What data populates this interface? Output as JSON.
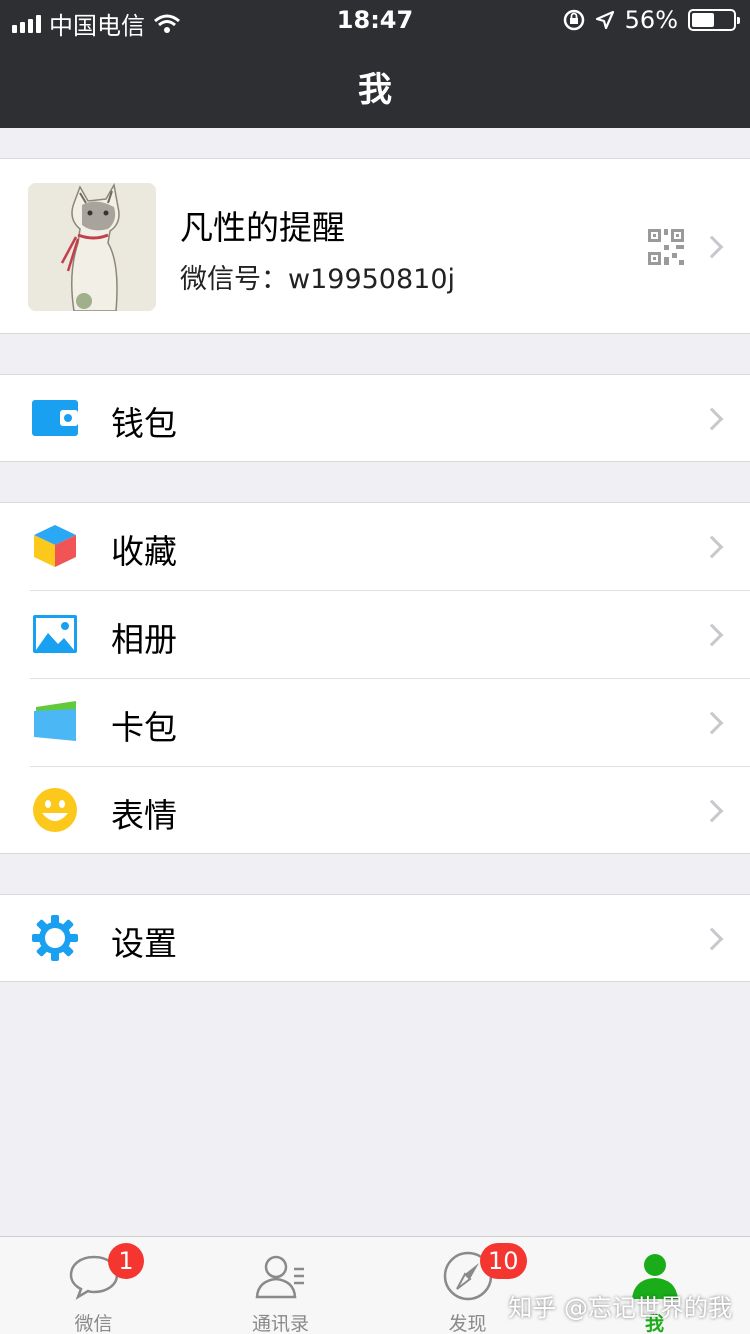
{
  "status_bar": {
    "carrier": "中国电信",
    "time": "18:47",
    "battery": "56%",
    "battery_level": 0.56
  },
  "nav": {
    "title": "我"
  },
  "profile": {
    "name": "凡性的提醒",
    "wechat_id": "微信号：w19950810j"
  },
  "menu": {
    "wallet": "钱包",
    "favorites": "收藏",
    "album": "相册",
    "cards": "卡包",
    "stickers": "表情",
    "settings": "设置"
  },
  "tabbar": {
    "chats": {
      "label": "微信",
      "badge": "1"
    },
    "contacts": {
      "label": "通讯录"
    },
    "discover": {
      "label": "发现",
      "badge": "10"
    },
    "me": {
      "label": "我"
    }
  },
  "watermark": "知乎 @忘记世界的我",
  "colors": {
    "nav_bg": "#2e2f33",
    "active_tab": "#1aad19",
    "badge": "#f43530",
    "icon_blue": "#1aa0f0"
  }
}
